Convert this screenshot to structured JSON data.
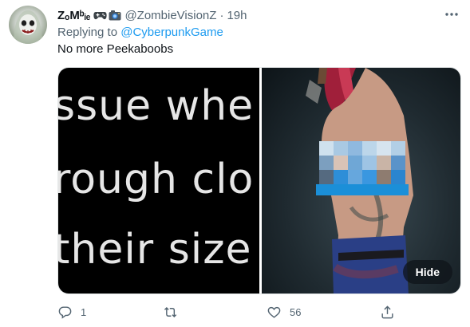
{
  "author": {
    "display_name": "ZₒMᵇᵢₑ",
    "handle": "@ZombieVisionZ",
    "separator": "·",
    "time": "19h"
  },
  "reply": {
    "prefix": "Replying to ",
    "mention": "@CyberpunkGame"
  },
  "tweet": {
    "text": "No more Peekaboobs"
  },
  "media": {
    "left_text_lines": [
      "ssue whe",
      "rough clo",
      "their size"
    ],
    "hide_label": "Hide"
  },
  "actions": {
    "reply_count": "1",
    "retweet_count": "",
    "like_count": "56"
  },
  "colors": {
    "link": "#1d9bf0",
    "secondary_text": "#536471"
  },
  "icons": [
    "game-controller-icon",
    "camera-icon",
    "more-icon",
    "reply-icon",
    "retweet-icon",
    "like-icon",
    "share-icon"
  ]
}
